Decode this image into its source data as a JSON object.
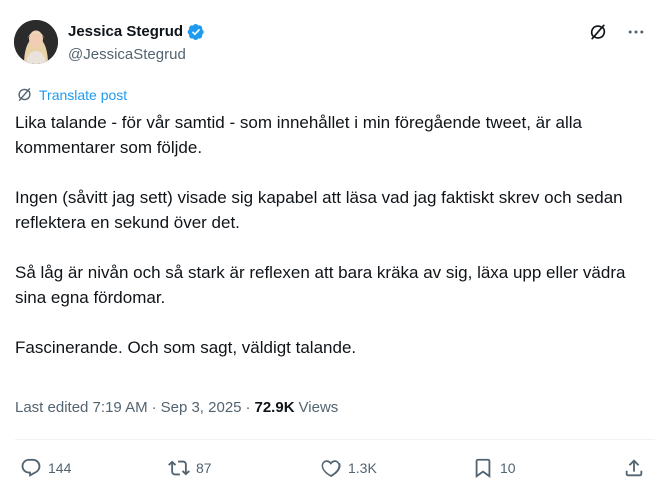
{
  "author": {
    "name": "Jessica Stegrud",
    "handle": "@JessicaStegrud",
    "verified": true
  },
  "translate_label": "Translate post",
  "post": {
    "paragraphs": [
      "Lika talande - för vår samtid - som innehållet i min föregående tweet, är alla kommentarer som följde.",
      "Ingen (såvitt jag sett) visade sig kapabel att läsa vad jag faktiskt skrev och sedan reflektera en sekund över det.",
      "Så låg är nivån och så stark är reflexen att bara kräka av sig, läxa upp eller vädra sina egna fördomar.",
      "Fascinerande. Och som sagt, väldigt talande."
    ]
  },
  "meta": {
    "edited": "Last edited 7:19 AM",
    "separator": "·",
    "date": "Sep 3, 2025",
    "views_count": "72.9K",
    "views_label": "Views"
  },
  "actions": {
    "replies": "144",
    "reposts": "87",
    "likes": "1.3K",
    "bookmarks": "10"
  },
  "icons": {
    "top_right": [
      "grok-icon",
      "more-icon"
    ],
    "actions": [
      "reply-icon",
      "repost-icon",
      "like-icon",
      "bookmark-icon",
      "share-icon"
    ]
  },
  "colors": {
    "accent": "#1d9bf0",
    "text": "#0f1419",
    "secondary": "#536471",
    "divider": "#eff3f4"
  }
}
